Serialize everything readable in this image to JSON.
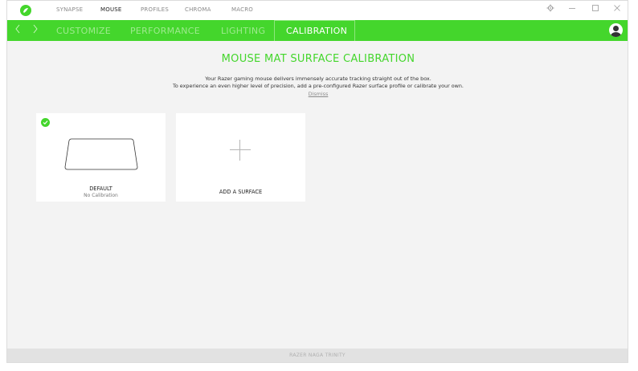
{
  "top_tabs": [
    {
      "label": "SYNAPSE",
      "active": false
    },
    {
      "label": "MOUSE",
      "active": true
    },
    {
      "label": "PROFILES",
      "active": false
    },
    {
      "label": "CHROMA",
      "active": false
    },
    {
      "label": "MACRO",
      "active": false
    }
  ],
  "window_controls": {
    "settings_icon": "gear-icon",
    "minimize_icon": "minimize-icon",
    "maximize_icon": "maximize-icon",
    "close_icon": "close-icon"
  },
  "nav": {
    "back_icon": "chevron-left-icon",
    "forward_icon": "chevron-right-icon",
    "tabs": [
      {
        "label": "CUSTOMIZE",
        "active": false
      },
      {
        "label": "PERFORMANCE",
        "active": false
      },
      {
        "label": "LIGHTING",
        "active": false
      },
      {
        "label": "CALIBRATION",
        "active": true
      }
    ],
    "user_icon": "user-icon"
  },
  "main": {
    "title": "MOUSE MAT SURFACE CALIBRATION",
    "description_line1": "Your Razer gaming mouse delivers immensely accurate tracking straight out of the box.",
    "description_line2": "To experience an even higher level of precision, add a pre-configured Razer surface profile or calibrate your own.",
    "dismiss_label": "Dismiss",
    "cards": [
      {
        "title": "DEFAULT",
        "subtitle": "No Calibration",
        "selected": true
      },
      {
        "title": "ADD A SURFACE"
      }
    ]
  },
  "footer": {
    "device_name": "RAZER NAGA TRINITY"
  },
  "colors": {
    "accent": "#44d62c",
    "background": "#f3f3f3",
    "card": "#ffffff"
  }
}
